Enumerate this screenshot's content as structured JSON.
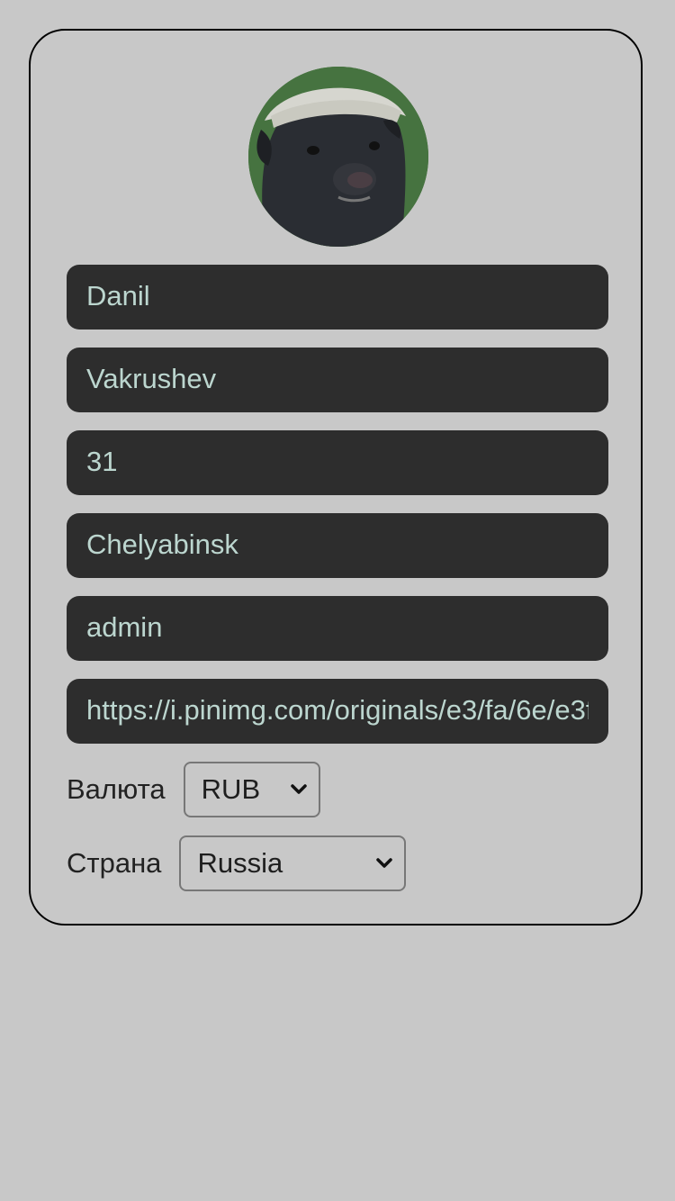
{
  "profile": {
    "avatar_icon": "honey-badger-photo",
    "first_name": "Danil",
    "last_name": "Vakrushev",
    "age": "31",
    "city": "Chelyabinsk",
    "role": "admin",
    "avatar_url": "https://i.pinimg.com/originals/e3/fa/6e/e3fa6e"
  },
  "currency": {
    "label": "Валюта",
    "selected": "RUB"
  },
  "country": {
    "label": "Страна",
    "selected": "Russia"
  },
  "colors": {
    "page_bg": "#c8c8c8",
    "field_bg": "#2d2d2d",
    "field_text": "#bcd6cf",
    "card_border": "#000000"
  }
}
